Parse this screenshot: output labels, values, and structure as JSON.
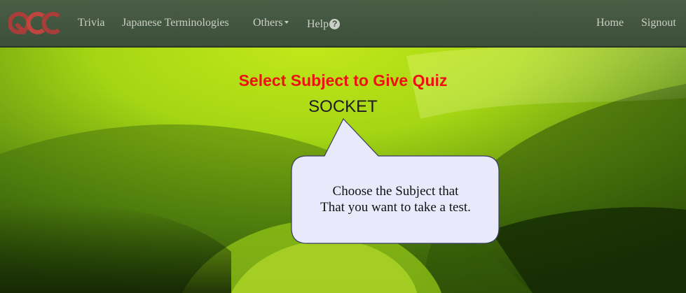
{
  "logo": {
    "text": "QCC"
  },
  "nav": {
    "trivia": "Trivia",
    "japanese_terminologies": "Japanese Terminologies",
    "others": "Others",
    "help": "Help",
    "home": "Home",
    "signout": "Signout"
  },
  "icons": {
    "others_dropdown": "caret-down-icon",
    "help": "question-circle-icon"
  },
  "main": {
    "title": "Select Subject to Give Quiz",
    "subject": "SOCKET",
    "tooltip_line1": "Choose the Subject that",
    "tooltip_line2": "That you want to take a test."
  },
  "colors": {
    "navbar": "#3c4f39",
    "title": "#ee1111",
    "tooltip_fill": "#e8eafb",
    "background": "#6a9a10"
  }
}
